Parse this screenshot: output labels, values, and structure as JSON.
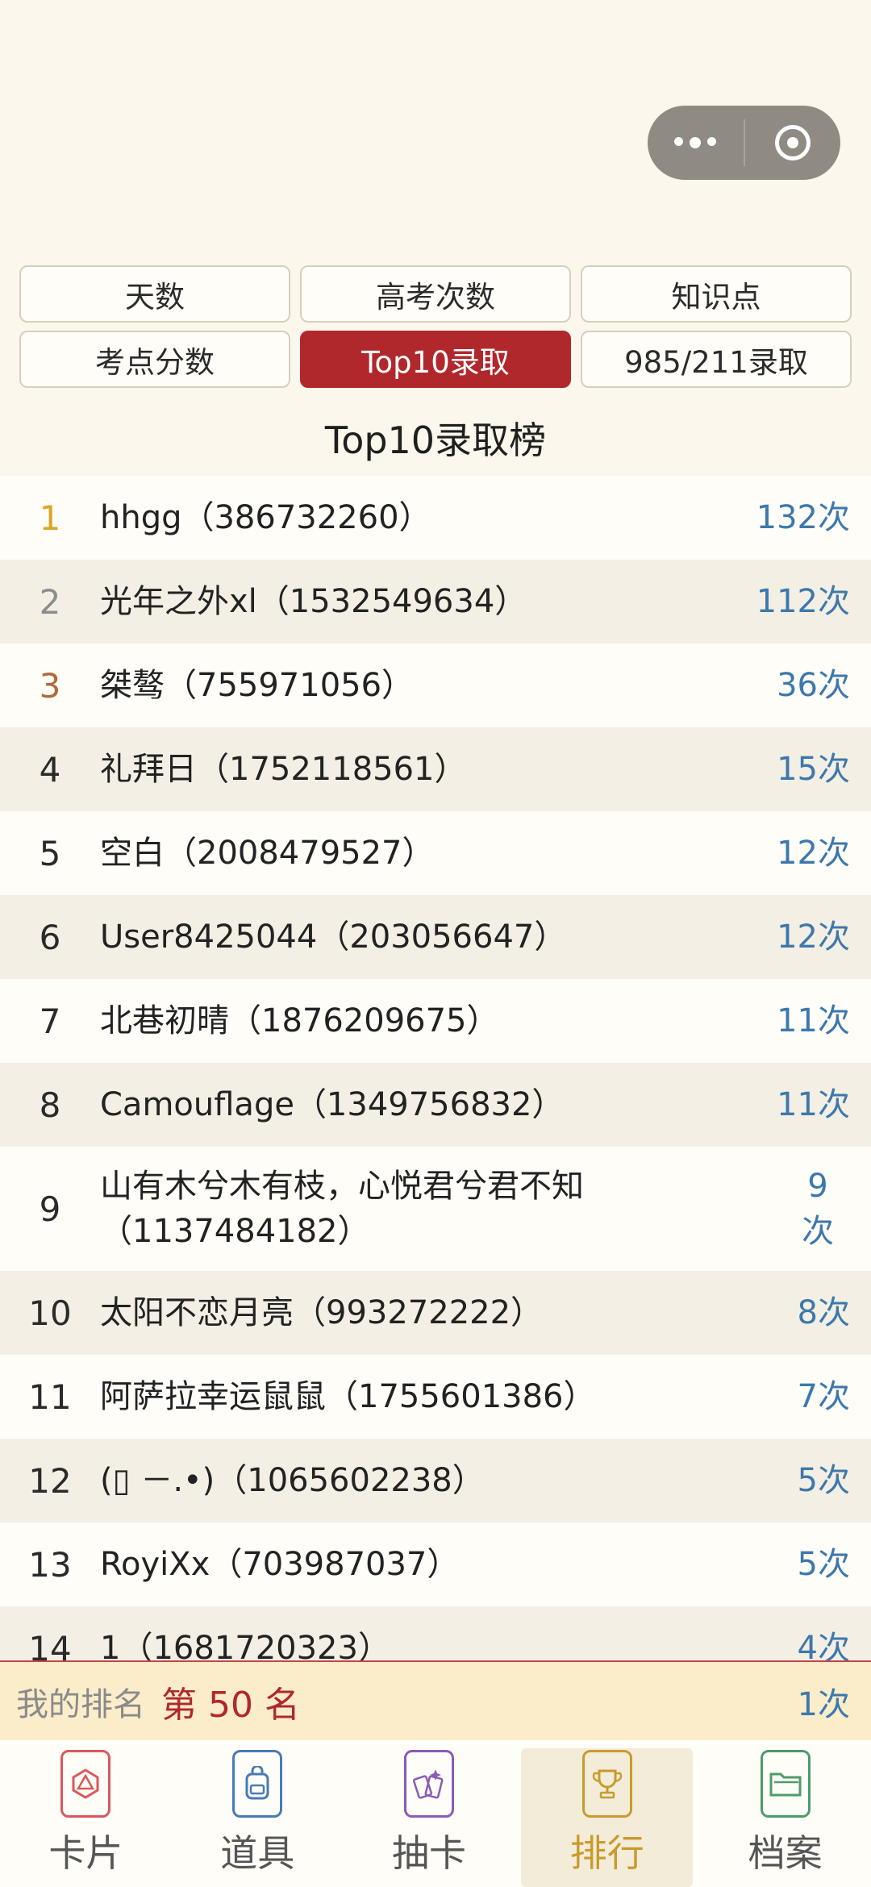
{
  "tabs": [
    {
      "label": "天数"
    },
    {
      "label": "高考次数"
    },
    {
      "label": "知识点"
    },
    {
      "label": "考点分数"
    },
    {
      "label": "Top10录取",
      "active": true
    },
    {
      "label": "985/211录取"
    }
  ],
  "list_title": "Top10录取榜",
  "rows": [
    {
      "rank": "1",
      "name": "hhgg（386732260）",
      "count": "132次"
    },
    {
      "rank": "2",
      "name": "光年之外xl（1532549634）",
      "count": "112次"
    },
    {
      "rank": "3",
      "name": "桀骜（755971056）",
      "count": "36次"
    },
    {
      "rank": "4",
      "name": "礼拜日（1752118561）",
      "count": "15次"
    },
    {
      "rank": "5",
      "name": "空白（2008479527）",
      "count": "12次"
    },
    {
      "rank": "6",
      "name": "User8425044（203056647）",
      "count": "12次"
    },
    {
      "rank": "7",
      "name": "北巷初晴（1876209675）",
      "count": "11次"
    },
    {
      "rank": "8",
      "name": "Camouflage（1349756832）",
      "count": "11次"
    },
    {
      "rank": "9",
      "name": "山有木兮木有枝，心悦君兮君不知（1137484182）",
      "count": "9次"
    },
    {
      "rank": "10",
      "name": "太阳不恋月亮（993272222）",
      "count": "8次"
    },
    {
      "rank": "11",
      "name": "阿萨拉幸运鼠鼠（1755601386）",
      "count": "7次"
    },
    {
      "rank": "12",
      "name": "(▯ －.•)（1065602238）",
      "count": "5次"
    },
    {
      "rank": "13",
      "name": "RoyiXx（703987037）",
      "count": "5次"
    },
    {
      "rank": "14",
      "name": "1（1681720323）",
      "count": "4次"
    }
  ],
  "my_rank": {
    "label": "我的排名",
    "position": "第 50 名",
    "count": "1次"
  },
  "nav": [
    {
      "label": "卡片",
      "icon": "dice-card-icon",
      "color": "#d9585c"
    },
    {
      "label": "道具",
      "icon": "backpack-icon",
      "color": "#4a79b8"
    },
    {
      "label": "抽卡",
      "icon": "cards-draw-icon",
      "color": "#8a5bb8"
    },
    {
      "label": "排行",
      "icon": "trophy-icon",
      "color": "#c99b2c",
      "active": true
    },
    {
      "label": "档案",
      "icon": "folder-icon",
      "color": "#4f9a6b"
    }
  ],
  "colors": {
    "accent": "#b1282c",
    "count_blue": "#3d78ac",
    "gold": "#d8a726",
    "silver": "#8c8c8c",
    "bronze": "#b06a36"
  }
}
